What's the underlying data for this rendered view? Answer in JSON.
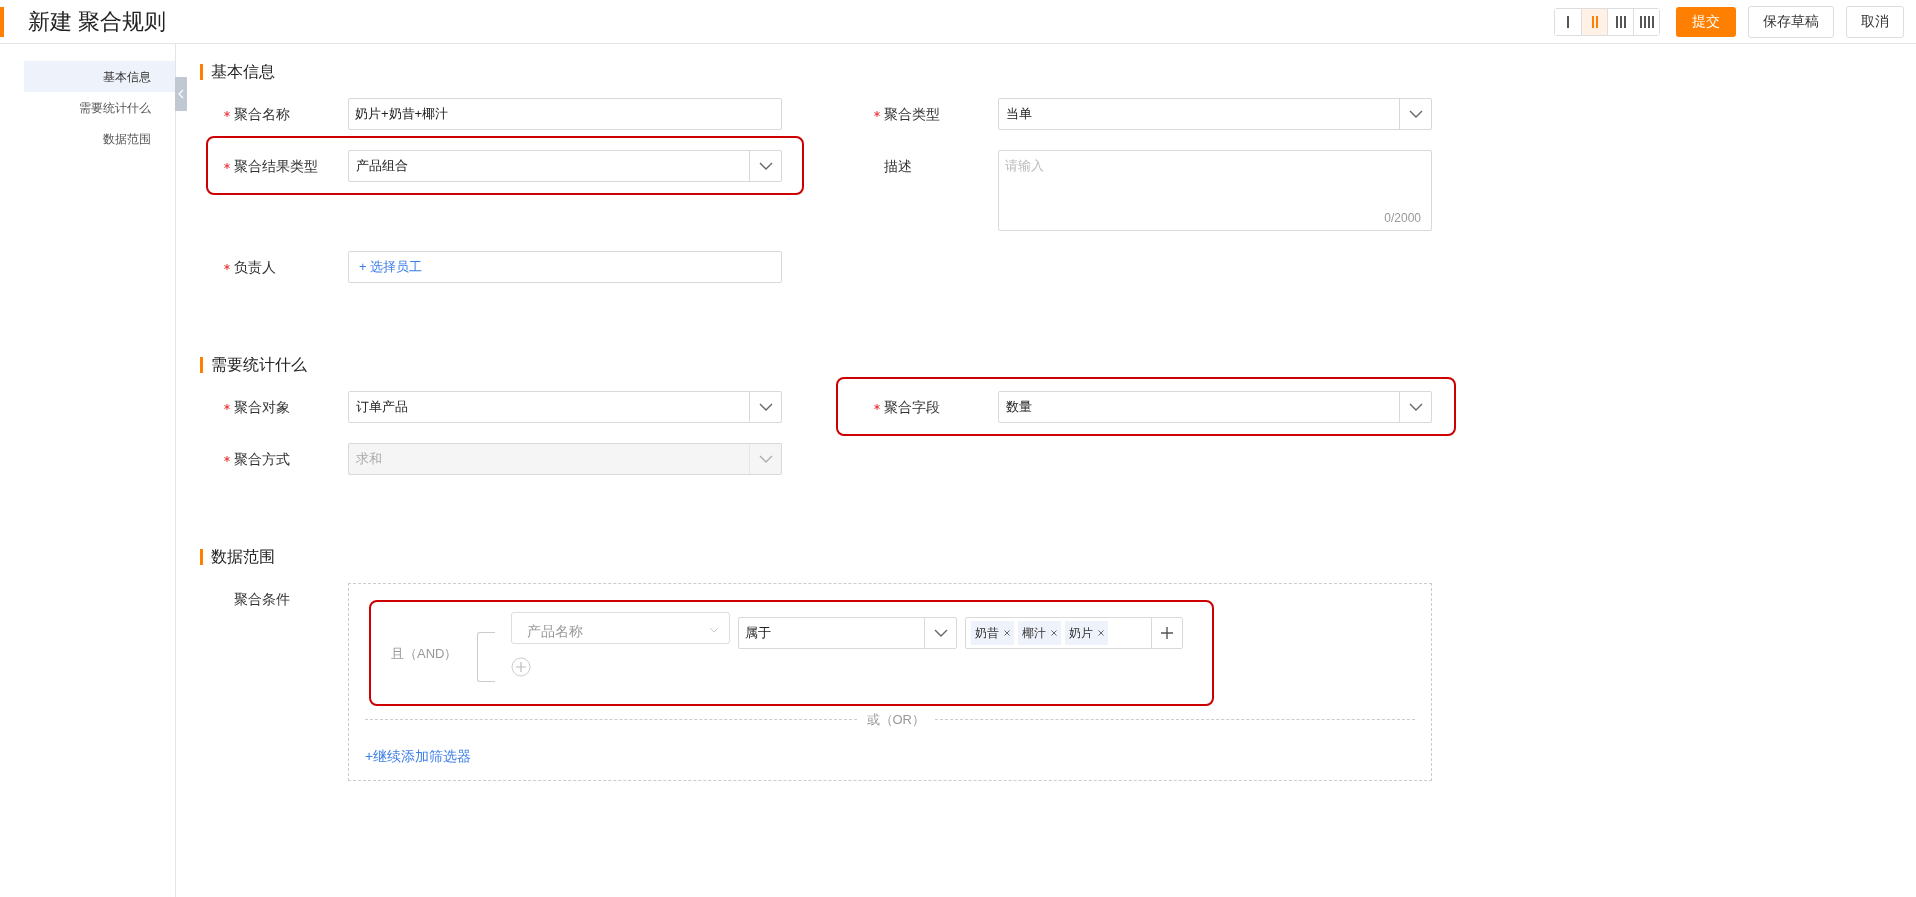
{
  "header": {
    "title": "新建 聚合规则",
    "layout_options": [
      {
        "selected": false
      },
      {
        "selected": true
      },
      {
        "selected": false
      },
      {
        "selected": false
      }
    ],
    "buttons": [
      {
        "label": "提交",
        "kind": "primary"
      },
      {
        "label": "保存草稿",
        "kind": "default"
      },
      {
        "label": "取消",
        "kind": "default"
      }
    ]
  },
  "sidebar": {
    "items": [
      {
        "label": "基本信息",
        "selected": true
      },
      {
        "label": "需要统计什么",
        "selected": false
      },
      {
        "label": "数据范围",
        "selected": false
      }
    ]
  },
  "sections": [
    {
      "title": "基本信息",
      "rows": [
        [
          {
            "label": "聚合名称",
            "required": true,
            "kind": "input",
            "value": "奶片+奶昔+椰汁",
            "highlighted": false
          },
          {
            "label": "聚合类型",
            "required": true,
            "kind": "select",
            "value": "当单",
            "highlighted": false
          }
        ],
        [
          {
            "label": "聚合结果类型",
            "required": true,
            "kind": "select",
            "value": "产品组合",
            "highlighted": true
          },
          {
            "label": "描述",
            "required": false,
            "kind": "textarea",
            "placeholder": "请输入",
            "counter": "0/2000",
            "highlighted": false
          }
        ],
        [
          {
            "label": "负责人",
            "required": true,
            "kind": "picker",
            "value": "+ 选择员工",
            "highlighted": false
          }
        ]
      ]
    },
    {
      "title": "需要统计什么",
      "rows": [
        [
          {
            "label": "聚合对象",
            "required": true,
            "kind": "select",
            "value": "订单产品",
            "highlighted": false
          },
          {
            "label": "聚合字段",
            "required": true,
            "kind": "select",
            "value": "数量",
            "highlighted": true
          }
        ],
        [
          {
            "label": "聚合方式",
            "required": true,
            "kind": "select",
            "value": "求和",
            "disabled": true,
            "highlighted": false
          }
        ]
      ]
    },
    {
      "title": "数据范围",
      "filter": {
        "label": "聚合条件",
        "group": {
          "logic": "且（AND）",
          "highlighted": true,
          "conditions": [
            {
              "field_placeholder": "产品名称",
              "operator": "属于",
              "values": [
                "奶昔",
                "椰汁",
                "奶片"
              ]
            }
          ]
        },
        "or_label": "或（OR）",
        "add_filter": "+继续添加筛选器"
      }
    }
  ]
}
